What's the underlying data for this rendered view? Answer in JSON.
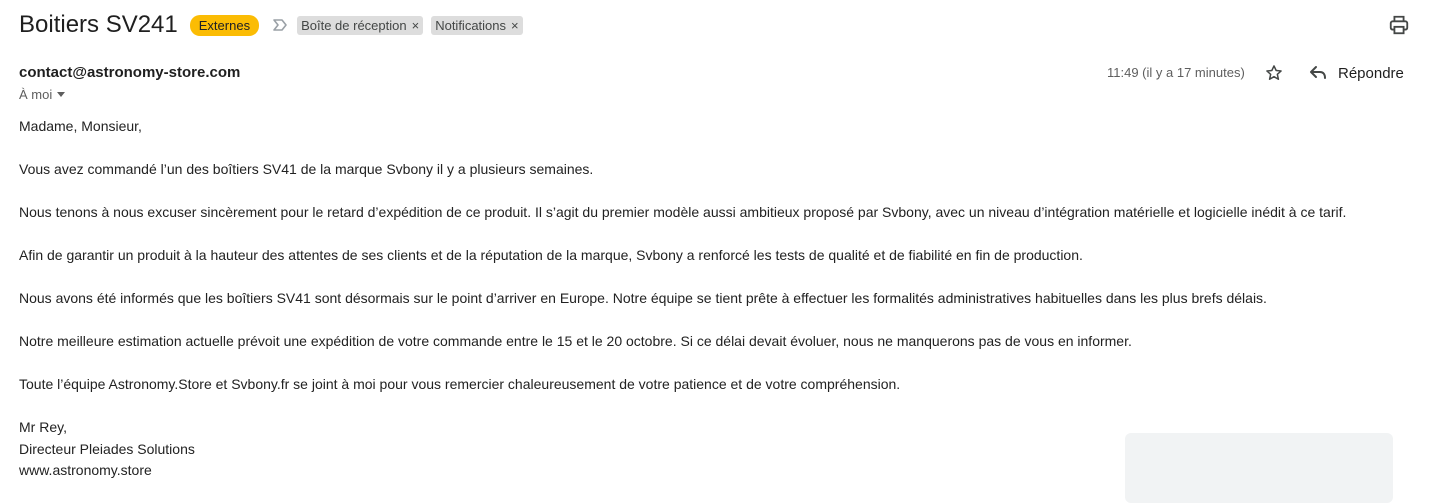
{
  "email": {
    "subject": "Boitiers SV241",
    "external_badge": "Externes",
    "labels": [
      {
        "name": "Boîte de réception",
        "close": "×"
      },
      {
        "name": "Notifications",
        "close": "×"
      }
    ],
    "sender": "contact@astronomy-store.com",
    "recipient": "À moi",
    "timestamp": "11:49 (il y a 17 minutes)",
    "reply_label": "Répondre",
    "body": {
      "p1": "Madame, Monsieur,",
      "p2": "Vous avez commandé l’un des boîtiers SV41 de la marque Svbony il y a plusieurs semaines.",
      "p3": "Nous tenons à nous excuser sincèrement pour le retard d’expédition de ce produit. Il s’agit du premier modèle aussi ambitieux proposé par Svbony, avec un niveau d’intégration matérielle et logicielle inédit à ce tarif.",
      "p4": "Afin de garantir un produit à la hauteur des attentes de ses clients et de la réputation de la marque, Svbony a renforcé les tests de qualité et de fiabilité en fin de production.",
      "p5": "Nous avons été informés que les boîtiers SV41 sont désormais sur le point d’arriver en Europe. Notre équipe se tient prête à effectuer les formalités administratives habituelles dans les plus brefs délais.",
      "p6": "Notre meilleure estimation actuelle prévoit une expédition de votre commande entre le 15 et le 20 octobre. Si ce délai devait évoluer, nous ne manquerons pas de vous en informer.",
      "p7": "Toute l’équipe Astronomy.Store et Svbony.fr se joint à moi pour vous remercier chaleureusement de votre patience et de votre compréhension.",
      "sig1": "Mr Rey,",
      "sig2": "Directeur Pleiades Solutions",
      "sig3": "www.astronomy.store"
    }
  },
  "icons": {
    "print": "printer-icon",
    "star": "star-icon",
    "reply": "reply-icon",
    "importance": "importance-marker-icon",
    "caret": "chevron-down-icon"
  },
  "colors": {
    "external_badge": "#fbbc04",
    "label_chip": "#dddddd",
    "text": "#202124",
    "secondary_text": "#5e5e5e"
  }
}
